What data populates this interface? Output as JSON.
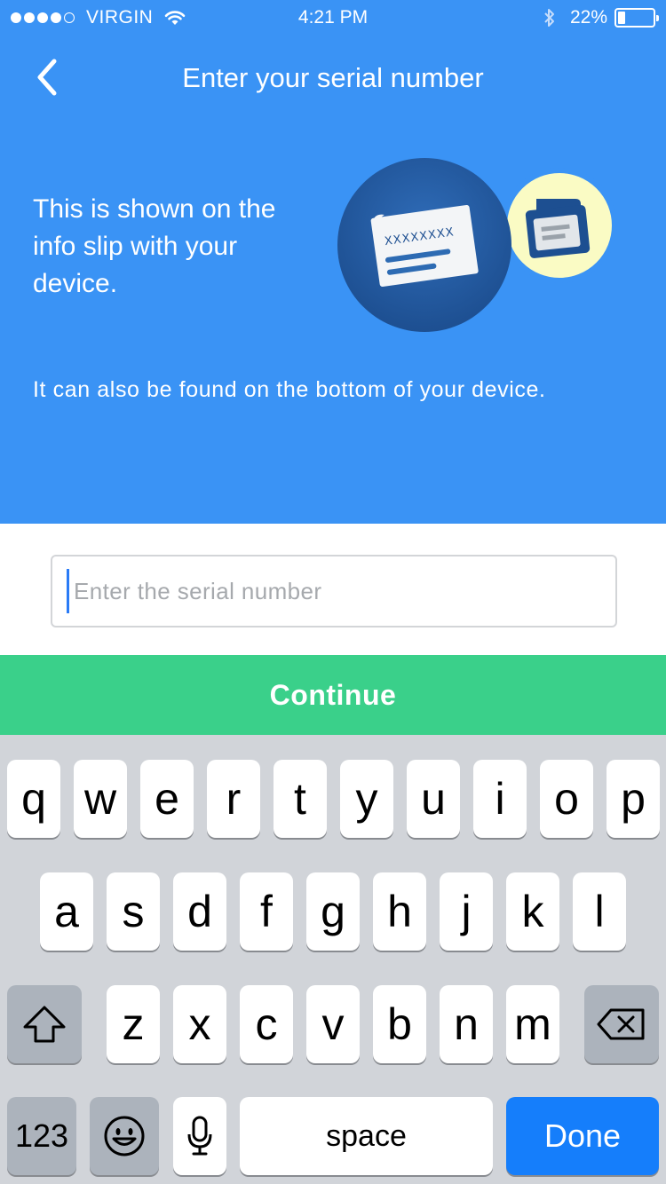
{
  "status_bar": {
    "carrier": "VIRGIN",
    "time": "4:21 PM",
    "battery_percent": "22%",
    "battery_level": 0.22
  },
  "nav": {
    "title": "Enter your serial number",
    "back_icon": "chevron-left-icon"
  },
  "info": {
    "text": "This is shown on the info slip with your device.",
    "subtext": "It can also be found on the bottom of your device.",
    "slip_code": "XXXXXXXX"
  },
  "form": {
    "serial_placeholder": "Enter the serial number",
    "serial_value": ""
  },
  "continue_label": "Continue",
  "keyboard": {
    "row1": [
      "q",
      "w",
      "e",
      "r",
      "t",
      "y",
      "u",
      "i",
      "o",
      "p"
    ],
    "row2": [
      "a",
      "s",
      "d",
      "f",
      "g",
      "h",
      "j",
      "k",
      "l"
    ],
    "row3": [
      "z",
      "x",
      "c",
      "v",
      "b",
      "n",
      "m"
    ],
    "numbers_label": "123",
    "space_label": "space",
    "done_label": "Done"
  },
  "colors": {
    "header_bg": "#3a93f5",
    "continue_bg": "#3ad08a",
    "done_key_bg": "#157efb",
    "keyboard_bg": "#d1d4d9"
  }
}
